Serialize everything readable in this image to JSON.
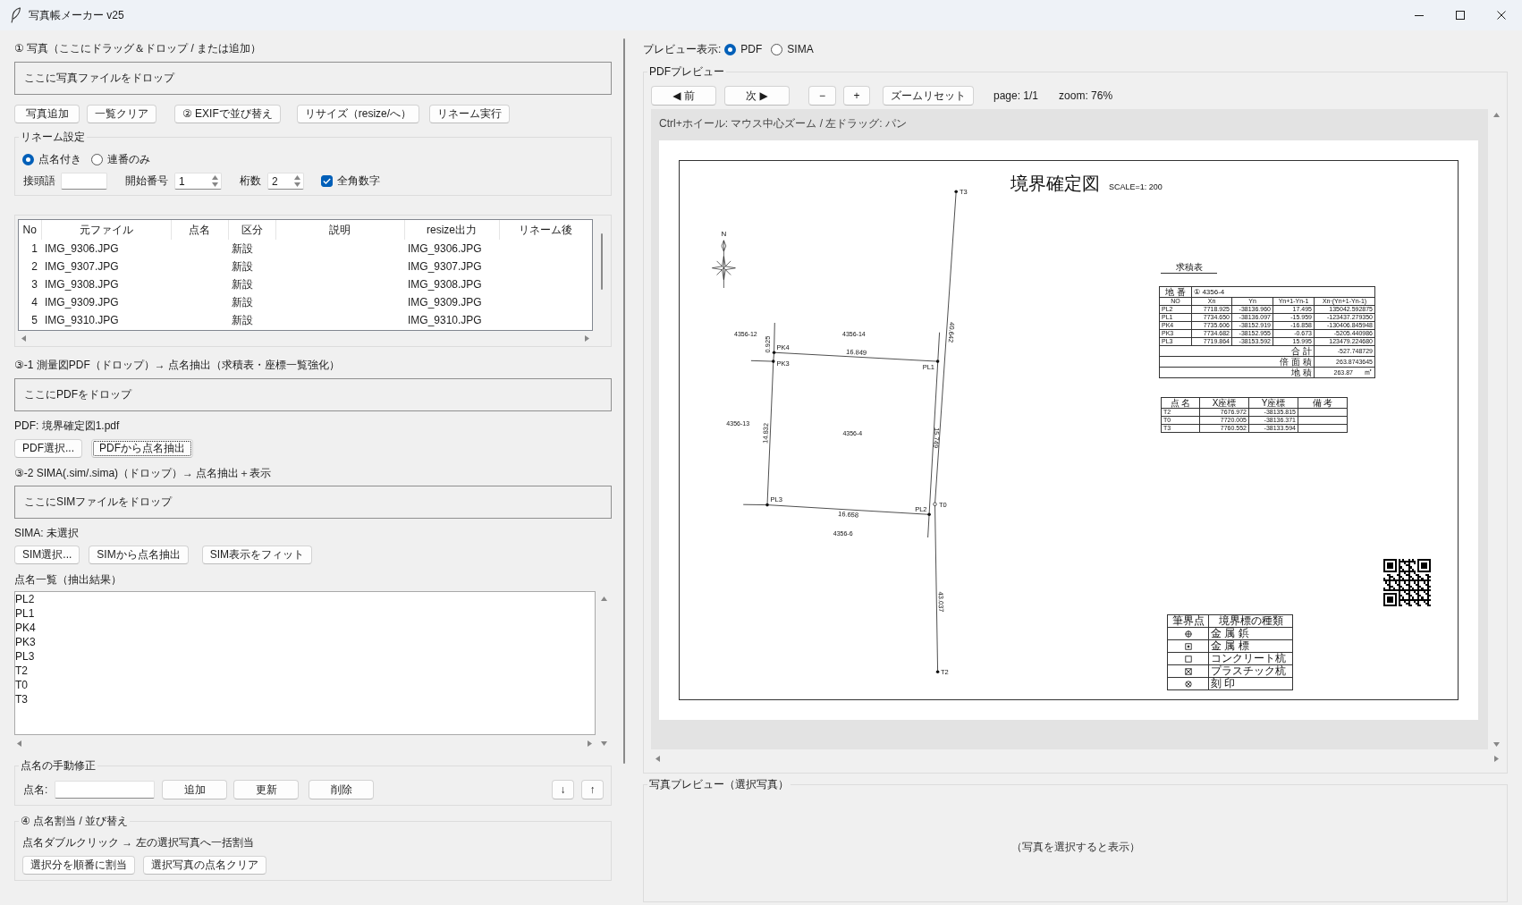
{
  "window": {
    "title": "写真帳メーカー v25"
  },
  "photos": {
    "heading": "① 写真（ここにドラッグ＆ドロップ / または追加）",
    "drop_zone": "ここに写真ファイルをドロップ",
    "buttons": [
      "写真追加",
      "一覧クリア",
      "② EXIFで並び替え",
      "リサイズ（resize/へ）",
      "リネーム実行"
    ]
  },
  "rename_settings": {
    "title": "リネーム設定",
    "modes": [
      {
        "label": "点名付き",
        "selected": true
      },
      {
        "label": "連番のみ",
        "selected": false
      }
    ],
    "prefix": {
      "label": "接頭語"
    },
    "start_number": {
      "label": "開始番号",
      "value": "1"
    },
    "digits": {
      "label": "桁数",
      "value": "2"
    },
    "fullwidth_digits": {
      "label": "全角数字",
      "checked": true
    }
  },
  "photo_table": {
    "columns": [
      "No",
      "元ファイル",
      "点名",
      "区分",
      "説明",
      "resize出力",
      "リネーム後"
    ],
    "rows": [
      {
        "no": "1",
        "file": "IMG_9306.JPG",
        "category": "新設",
        "resize_output": "IMG_9306.JPG",
        "selected": false
      },
      {
        "no": "2",
        "file": "IMG_9307.JPG",
        "category": "新設",
        "resize_output": "IMG_9307.JPG",
        "selected": false
      },
      {
        "no": "3",
        "file": "IMG_9308.JPG",
        "category": "新設",
        "resize_output": "IMG_9308.JPG",
        "selected": false
      },
      {
        "no": "4",
        "file": "IMG_9309.JPG",
        "category": "新設",
        "resize_output": "IMG_9309.JPG",
        "selected": false
      },
      {
        "no": "5",
        "file": "IMG_9310.JPG",
        "category": "新設",
        "resize_output": "IMG_9310.JPG",
        "selected": false
      }
    ]
  },
  "pdf_section": {
    "heading": "③-1 測量図PDF（ドロップ）→ 点名抽出（求積表・座標一覧強化）",
    "drop_zone": "ここにPDFをドロップ",
    "file": "PDF: 境界確定図1.pdf",
    "buttons": [
      {
        "label": "PDF選択...",
        "focused": false
      },
      {
        "label": "PDFから点名抽出",
        "focused": true
      }
    ]
  },
  "sima_section": {
    "heading": "③-2 SIMA(.sim/.sima)（ドロップ）→ 点名抽出＋表示",
    "drop_zone": "ここにSIMファイルをドロップ",
    "file": "SIMA: 未選択",
    "buttons": [
      "SIM選択...",
      "SIMから点名抽出",
      "SIM表示をフィット"
    ]
  },
  "point_list": {
    "title": "点名一覧（抽出結果）",
    "items": [
      {
        "label": "PL2",
        "selected": false
      },
      {
        "label": "PL1",
        "selected": false
      },
      {
        "label": "PK4",
        "selected": false
      },
      {
        "label": "PK3",
        "selected": false
      },
      {
        "label": "PL3",
        "selected": false
      },
      {
        "label": "T2",
        "selected": false
      },
      {
        "label": "T0",
        "selected": false
      },
      {
        "label": "T3",
        "selected": false
      }
    ]
  },
  "manual_edit": {
    "title": "点名の手動修正",
    "field_label": "点名:",
    "buttons": [
      "追加",
      "更新",
      "削除"
    ],
    "move_buttons": [
      "↓",
      "↑"
    ]
  },
  "assign": {
    "title": "④ 点名割当 / 並び替え",
    "hint": "点名ダブルクリック → 左の選択写真へ一括割当",
    "buttons": [
      "選択分を順番に割当",
      "選択写真の点名クリア"
    ]
  },
  "preview_mode": {
    "label": "プレビュー表示:",
    "options": [
      {
        "label": "PDF",
        "selected": true
      },
      {
        "label": "SIMA",
        "selected": false
      }
    ]
  },
  "pdf_preview": {
    "title": "PDFプレビュー",
    "nav_buttons": [
      "◀ 前",
      "次 ▶"
    ],
    "zoom_buttons": [
      "−",
      "+"
    ],
    "reset_button": "ズームリセット",
    "page_info": "page: 1/1",
    "zoom_info": "zoom: 76%",
    "hint": "Ctrl+ホイール: マウス中心ズーム / 左ドラッグ: パン",
    "drawing": {
      "title": "境界確定図",
      "scale": "SCALE=1: 200",
      "north": "N",
      "parcels": [
        "4356-12",
        "4356-14",
        "4356-13",
        "4356-4",
        "4356-6"
      ],
      "points": [
        {
          "label": "T3",
          "kind": "filled"
        },
        {
          "label": "PK4",
          "kind": "filled"
        },
        {
          "label": "PK3",
          "kind": "filled"
        },
        {
          "label": "PL1",
          "kind": "filled"
        },
        {
          "label": "T0",
          "kind": "open"
        },
        {
          "label": "PL3",
          "kind": "filled"
        },
        {
          "label": "PL2",
          "kind": "filled"
        },
        {
          "label": "T2",
          "kind": "filled"
        }
      ],
      "distances": [
        "0.925",
        "16.849",
        "14.832",
        "15.749",
        "16.658",
        "40.642",
        "43.037"
      ],
      "area_table": {
        "title": "求積表",
        "lot_label": "地 番",
        "lot": "① 4356-4",
        "columns": [
          "NO",
          "Xn",
          "Yn",
          "Yn+1-Yn-1",
          "Xn·(Yn+1-Yn-1)"
        ],
        "rows": [
          [
            "PL2",
            "7718.925",
            "-38136.960",
            "17.495",
            "135042.592875"
          ],
          [
            "PL1",
            "7734.650",
            "-38136.097",
            "-15.959",
            "-123437.279350"
          ],
          [
            "PK4",
            "7735.606",
            "-38152.919",
            "-16.858",
            "-130406.845948"
          ],
          [
            "PK3",
            "7734.682",
            "-38152.955",
            "-0.673",
            "-5205.440986"
          ],
          [
            "PL3",
            "7719.864",
            "-38153.592",
            "15.995",
            "123479.224680"
          ]
        ],
        "totals": [
          {
            "label": "合 計",
            "value": "-527.748729"
          },
          {
            "label": "倍 面 積",
            "value": "263.8743645"
          },
          {
            "label": "地 積",
            "value": "263.87",
            "unit": "㎡"
          }
        ]
      },
      "coordinate_table": {
        "columns": [
          "点 名",
          "X座標",
          "Y座標",
          "備 考"
        ],
        "rows": [
          [
            "T2",
            "7676.972",
            "-38135.815"
          ],
          [
            "T0",
            "7720.005",
            "-38136.371"
          ],
          [
            "T3",
            "7760.552",
            "-38133.594"
          ]
        ]
      },
      "marker_legend": {
        "columns": [
          "筆界点",
          "境界標の種類"
        ],
        "rows": [
          {
            "kind": "circlecross",
            "label": "金 属 鋲"
          },
          {
            "kind": "squaredot",
            "label": "金 属 標"
          },
          {
            "kind": "square",
            "label": "コンクリート杭"
          },
          {
            "kind": "squarecross",
            "label": "プラスチック杭"
          },
          {
            "kind": "circlex",
            "label": "刻 印"
          }
        ]
      }
    }
  },
  "photo_preview": {
    "title": "写真プレビュー（選択写真）",
    "empty_message": "（写真を選択すると表示）"
  }
}
